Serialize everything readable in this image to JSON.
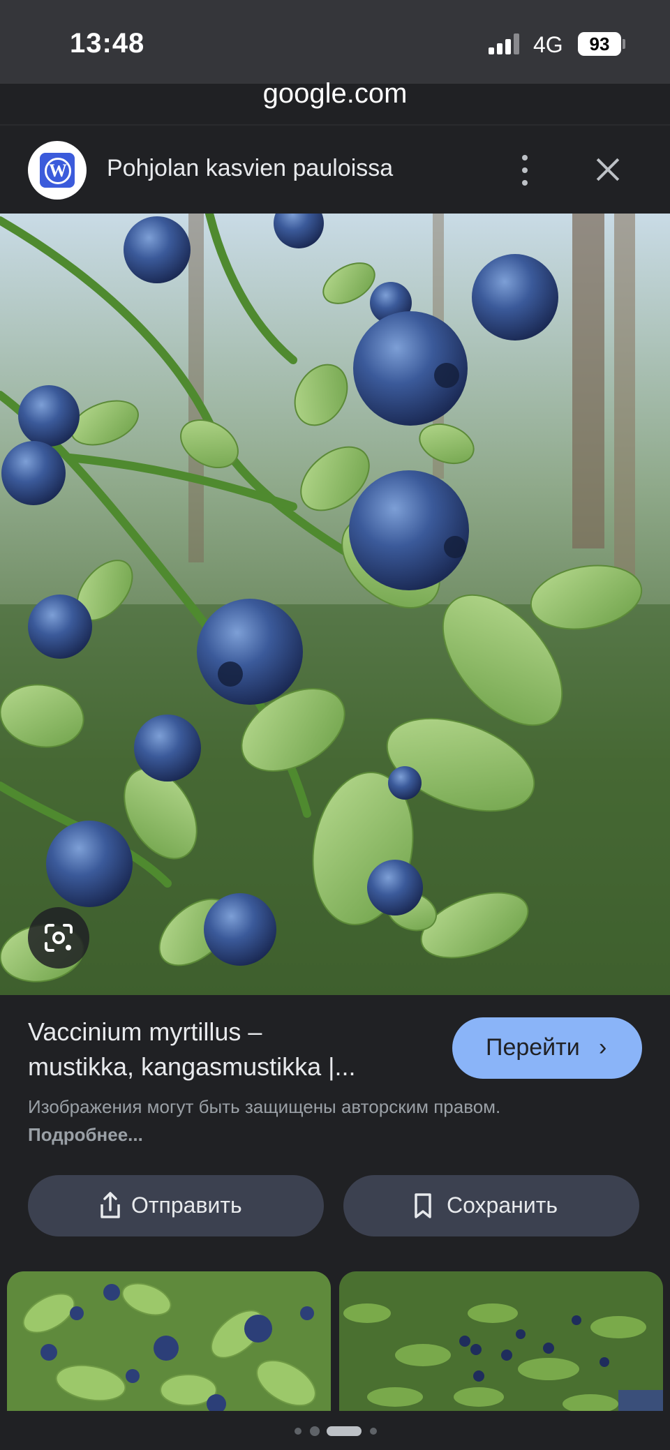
{
  "status_bar": {
    "time": "13:48",
    "network": "4G",
    "battery": "93"
  },
  "browser": {
    "url": "google.com"
  },
  "source": {
    "title": "Pohjolan kasvien pauloissa",
    "icon": "wordpress-icon"
  },
  "result": {
    "title_line1": "Vaccinium myrtillus –",
    "title_line2": "mustikka, kangasmustikka |...",
    "goto_label": "Перейти",
    "copyright_text": "Изображения могут быть защищены авторским правом.",
    "more_link": "Подробнее..."
  },
  "actions": {
    "share_label": "Отправить",
    "save_label": "Сохранить"
  },
  "pager": {
    "count": 5,
    "active": 2
  },
  "colors": {
    "background": "#202124",
    "accent": "#8ab4f8",
    "action_button": "#3c4150",
    "status_bar": "#35363a"
  }
}
